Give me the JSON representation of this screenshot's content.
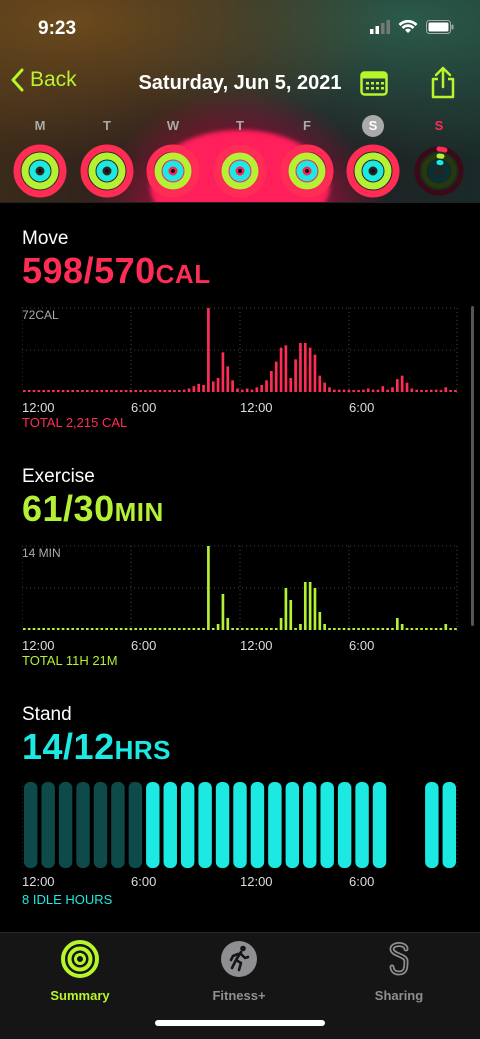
{
  "status": {
    "time": "9:23"
  },
  "nav": {
    "back_label": "Back",
    "title": "Saturday, Jun 5, 2021"
  },
  "days": [
    {
      "letter": "M"
    },
    {
      "letter": "T"
    },
    {
      "letter": "W"
    },
    {
      "letter": "T"
    },
    {
      "letter": "F"
    },
    {
      "letter": "S"
    },
    {
      "letter": "S"
    }
  ],
  "move": {
    "title": "Move",
    "value": "598/570",
    "unit": "CAL",
    "max_label": "72CAL",
    "total": "TOTAL 2,215 CAL",
    "color": "#ff2d55",
    "hours": [
      "12:00",
      "6:00",
      "12:00",
      "6:00"
    ],
    "chart_data": {
      "type": "bar",
      "ylim": [
        0,
        72
      ],
      "values": [
        1,
        1,
        1,
        1,
        1,
        1,
        1,
        1,
        1,
        1,
        1,
        1,
        1,
        1,
        1,
        1,
        1,
        1,
        1,
        1,
        1,
        1,
        1,
        1,
        1,
        1,
        1,
        1,
        1,
        1,
        1,
        1,
        1,
        2,
        3,
        5,
        7,
        6,
        72,
        9,
        12,
        34,
        22,
        10,
        3,
        2,
        3,
        2,
        4,
        6,
        10,
        18,
        26,
        38,
        40,
        12,
        28,
        42,
        42,
        38,
        32,
        14,
        8,
        4,
        2,
        2,
        2,
        2,
        1,
        1,
        2,
        3,
        2,
        2,
        5,
        2,
        4,
        11,
        14,
        8,
        3,
        2,
        1,
        1,
        2,
        2,
        1,
        4,
        1,
        1
      ]
    }
  },
  "exercise": {
    "title": "Exercise",
    "value": "61/30",
    "unit": "MIN",
    "max_label": "14 MIN",
    "total": "TOTAL 11H 21M",
    "color": "#b4f135",
    "hours": [
      "12:00",
      "6:00",
      "12:00",
      "6:00"
    ],
    "chart_data": {
      "type": "bar",
      "ylim": [
        0,
        14
      ],
      "values": [
        0,
        0,
        0,
        0,
        0,
        0,
        0,
        0,
        0,
        0,
        0,
        0,
        0,
        0,
        0,
        0,
        0,
        0,
        0,
        0,
        0,
        0,
        0,
        0,
        0,
        0,
        0,
        0,
        0,
        0,
        0,
        0,
        0,
        0,
        0,
        0,
        0,
        0,
        14,
        0,
        1,
        6,
        2,
        0,
        0,
        0,
        0,
        0,
        0,
        0,
        0,
        0,
        0,
        2,
        7,
        5,
        0,
        1,
        8,
        8,
        7,
        3,
        1,
        0,
        0,
        0,
        0,
        0,
        0,
        0,
        0,
        0,
        0,
        0,
        0,
        0,
        0,
        2,
        1,
        0,
        0,
        0,
        0,
        0,
        0,
        0,
        0,
        1,
        0,
        0
      ]
    }
  },
  "stand": {
    "title": "Stand",
    "value": "14/12",
    "unit": "HRS",
    "total": "8 IDLE HOURS",
    "color": "#1de9e3",
    "hours": [
      "12:00",
      "6:00",
      "12:00",
      "6:00"
    ],
    "chart_data": {
      "type": "bar",
      "hours_stood": [
        0,
        0,
        0,
        0,
        0,
        0,
        0,
        1,
        1,
        1,
        1,
        1,
        1,
        1,
        1,
        1,
        1,
        1,
        1,
        1,
        1,
        0,
        0,
        1,
        1
      ]
    }
  },
  "tabs": [
    {
      "label": "Summary",
      "icon": "rings-icon"
    },
    {
      "label": "Fitness+",
      "icon": "runner-icon"
    },
    {
      "label": "Sharing",
      "icon": "sharing-icon"
    }
  ]
}
